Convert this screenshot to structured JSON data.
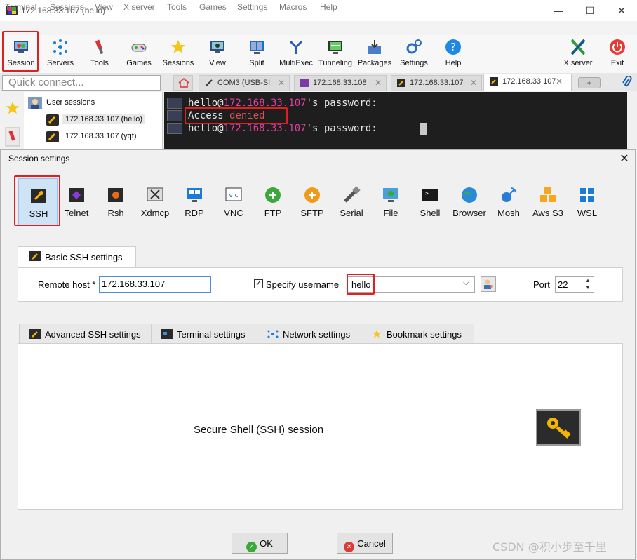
{
  "window": {
    "title": "172.168.33.107 (hello)"
  },
  "menu": [
    "Terminal",
    "Sessions",
    "View",
    "X server",
    "Tools",
    "Games",
    "Settings",
    "Macros",
    "Help"
  ],
  "toolbar": {
    "session": "Session",
    "servers": "Servers",
    "tools": "Tools",
    "games": "Games",
    "sessions": "Sessions",
    "view": "View",
    "split": "Split",
    "multiexec": "MultiExec",
    "tunneling": "Tunneling",
    "packages": "Packages",
    "settings": "Settings",
    "help": "Help",
    "xserver": "X server",
    "exit": "Exit"
  },
  "quick_connect": {
    "placeholder": "Quick connect..."
  },
  "tabs": [
    "COM3  (USB-SI",
    "172.168.33.108",
    "172.168.33.107",
    "172.168.33.107"
  ],
  "sidebar": {
    "root": "User sessions",
    "items": [
      "172.168.33.107 (hello)",
      "172.168.33.107 (yqf)"
    ]
  },
  "terminal": {
    "line1_user": "hello@",
    "line1_host": "172.168.33.107",
    "line1_rest": "'s password:",
    "line2_a": "Access ",
    "line2_b": "denied",
    "line3_user": "hello@",
    "line3_host": "172.168.33.107",
    "line3_rest": "'s password: "
  },
  "dialog": {
    "title": "Session settings",
    "session_types": [
      "SSH",
      "Telnet",
      "Rsh",
      "Xdmcp",
      "RDP",
      "VNC",
      "FTP",
      "SFTP",
      "Serial",
      "File",
      "Shell",
      "Browser",
      "Mosh",
      "Aws S3",
      "WSL"
    ],
    "basic_tab": "Basic SSH settings",
    "remote_host_label": "Remote host *",
    "remote_host_value": "172.168.33.107",
    "specify_username_label": "Specify username",
    "specify_username_checked": true,
    "username_value": "hello",
    "port_label": "Port",
    "port_value": "22",
    "sub_tabs": [
      "Advanced SSH settings",
      "Terminal settings",
      "Network settings",
      "Bookmark settings"
    ],
    "description": "Secure Shell (SSH) session",
    "ok": "OK",
    "cancel": "Cancel"
  },
  "watermark": "CSDN @积小步至千里",
  "colors": {
    "highlight_red": "#e02020",
    "terminal_bg": "#1e1e1e",
    "host_pink": "#e040a0"
  }
}
